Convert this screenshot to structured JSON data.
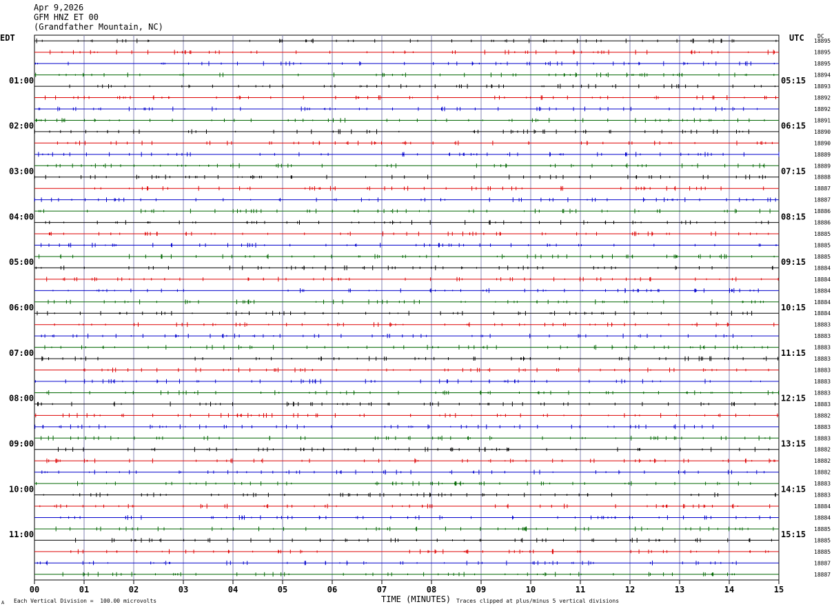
{
  "header": {
    "date": "Apr 9,2026",
    "station": "GFM HNZ ET 00",
    "location": "(Grandfather Mountain, NC)"
  },
  "left_tz": "EDT",
  "right_tz": "UTC",
  "dc_label": "DC",
  "footer": {
    "scale_note": "Each Vertical Division =  100.00 microvolts",
    "clip_note": "Traces clipped at plus/minus 5 vertical divisions",
    "corner_mark": "A"
  },
  "chart_data": {
    "type": "helicorder",
    "xlabel": "TIME (MINUTES)",
    "x_ticks": [
      "00",
      "01",
      "02",
      "03",
      "04",
      "05",
      "06",
      "07",
      "08",
      "09",
      "10",
      "11",
      "12",
      "13",
      "14",
      "15"
    ],
    "xlim": [
      0,
      15
    ],
    "trace_colors": [
      "#000000",
      "#dd0000",
      "#0000cc",
      "#006600"
    ],
    "left_hour_labels": [
      "01:00",
      "02:00",
      "03:00",
      "04:00",
      "05:00",
      "06:00",
      "07:00",
      "08:00",
      "09:00",
      "10:00",
      "11:00"
    ],
    "right_hour_labels": [
      "05:15",
      "06:15",
      "07:15",
      "08:15",
      "09:15",
      "10:15",
      "11:15",
      "12:15",
      "13:15",
      "14:15",
      "15:15"
    ],
    "dc_values": [
      "18895",
      "18895",
      "18895",
      "18894",
      "18893",
      "18892",
      "18892",
      "18891",
      "18890",
      "18890",
      "18889",
      "18889",
      "18888",
      "18887",
      "18887",
      "18886",
      "18886",
      "18885",
      "18885",
      "18885",
      "18884",
      "18884",
      "18884",
      "18884",
      "18884",
      "18883",
      "18883",
      "18883",
      "18883",
      "18883",
      "18883",
      "18883",
      "18883",
      "18882",
      "18883",
      "18883",
      "18882",
      "18882",
      "18882",
      "18883",
      "18883",
      "18884",
      "18884",
      "18885",
      "18885",
      "18885",
      "18887",
      "18887"
    ]
  }
}
